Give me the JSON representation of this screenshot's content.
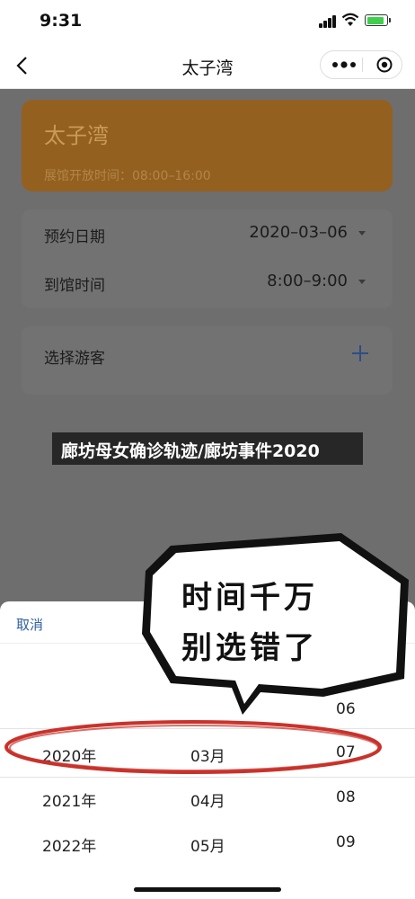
{
  "status_bar": {
    "time": "9:31"
  },
  "nav": {
    "title": "太子湾"
  },
  "venue": {
    "name": "太子湾",
    "hours": "展馆开放时间：08:00–16:00"
  },
  "form": {
    "date_label": "预约日期",
    "date_value": "2020–03–06",
    "time_label": "到馆时间",
    "time_value": "8:00–9:00"
  },
  "guests": {
    "label": "选择游客"
  },
  "caption": "廊坊母女确诊轨迹/廊坊事件2020",
  "sheet": {
    "cancel_label": "取消"
  },
  "picker": {
    "years": [
      "2020年",
      "2021年",
      "2022年"
    ],
    "months": [
      "03月",
      "04月",
      "05月"
    ],
    "days": [
      "06",
      "07",
      "08",
      "09"
    ]
  },
  "bubble": {
    "line1": "时间千万",
    "line2": "别选错了"
  },
  "colors": {
    "accent": "#2f5f9e",
    "highlight_ring": "#c9322b",
    "venue_card": "#946020"
  }
}
